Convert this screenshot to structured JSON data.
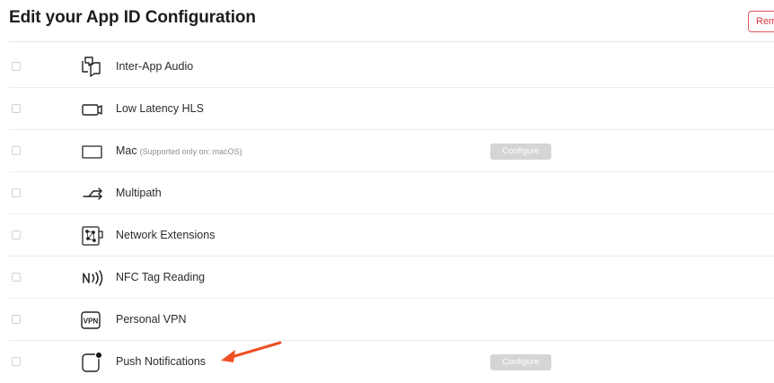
{
  "page": {
    "title": "Edit your App ID Configuration",
    "remove_label": "Remove"
  },
  "capabilities": [
    {
      "label": "Inter-App Audio",
      "icon": "inter-app-audio-icon"
    },
    {
      "label": "Low Latency HLS",
      "icon": "low-latency-hls-icon"
    },
    {
      "label": "Mac",
      "note": "(Supported only on: macOS)",
      "icon": "mac-icon",
      "configure_label": "Configure"
    },
    {
      "label": "Multipath",
      "icon": "multipath-icon"
    },
    {
      "label": "Network Extensions",
      "icon": "network-extensions-icon"
    },
    {
      "label": "NFC Tag Reading",
      "icon": "nfc-tag-reading-icon"
    },
    {
      "label": "Personal VPN",
      "icon": "personal-vpn-icon",
      "icon_text": "VPN"
    },
    {
      "label": "Push Notifications",
      "icon": "push-notifications-icon",
      "configure_label": "Configure"
    }
  ],
  "colors": {
    "remove_border": "#e0585a",
    "configure_disabled": "#d5d5d7",
    "annotation_arrow": "#f04e23"
  }
}
